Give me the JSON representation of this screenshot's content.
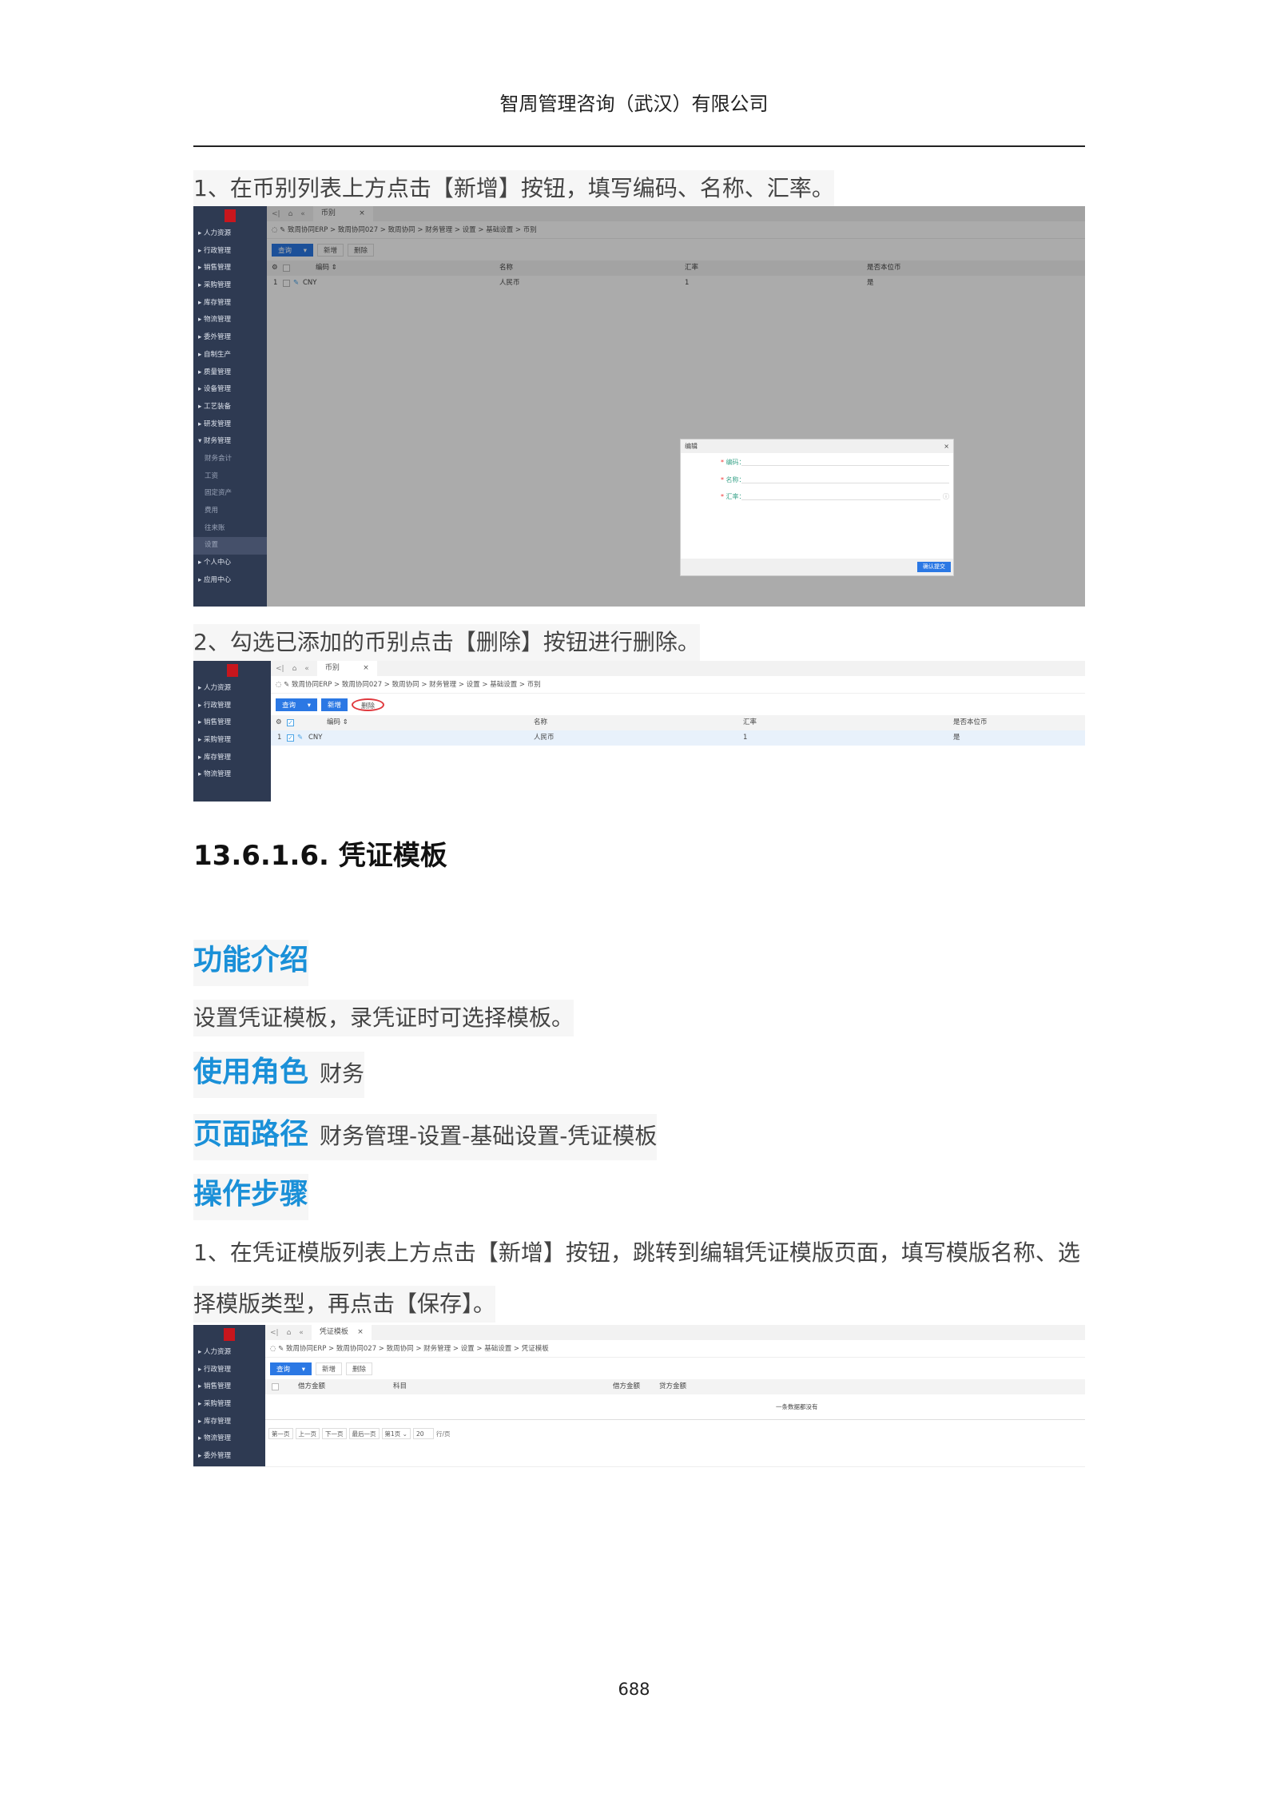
{
  "header": {
    "company": "智周管理咨询（武汉）有限公司"
  },
  "step1": "1、在币别列表上方点击【新增】按钮，填写编码、名称、汇率。",
  "step2": "2、勾选已添加的币别点击【删除】按钮进行删除。",
  "section_title": "13.6.1.6.  凭证模板",
  "intro": {
    "label": "功能介绍",
    "text": "设置凭证模板，录凭证时可选择模板。"
  },
  "role": {
    "label": "使用角色",
    "value": "财务"
  },
  "path": {
    "label": "页面路径",
    "value": "财务管理-设置-基础设置-凭证模板"
  },
  "steps": {
    "label": "操作步骤",
    "text1": "1、在凭证模版列表上方点击【新增】按钮，跳转到编辑凭证模版页面，填写模版名称、选",
    "text2": "择模版类型，再点击【保存】。"
  },
  "sidebar": {
    "items": [
      "人力资源",
      "行政管理",
      "销售管理",
      "采购管理",
      "库存管理",
      "物流管理",
      "委外管理",
      "自制生产",
      "质量管理",
      "设备管理",
      "工艺装备",
      "研发管理",
      "财务管理"
    ],
    "finance_sub": [
      "财务会计",
      "工资",
      "固定资产",
      "费用",
      "往来账",
      "设置"
    ],
    "bottom": [
      "个人中心",
      "应用中心"
    ]
  },
  "shot1": {
    "tab": "币别",
    "breadcrumb": "致周协同ERP > 致周协同027 > 致周协同 > 财务管理 > 设置 > 基础设置 > 币别",
    "query": "查询",
    "add": "新增",
    "delete": "删除",
    "columns": [
      "编码 ⇕",
      "名称",
      "汇率",
      "是否本位币"
    ],
    "row": {
      "index": "1",
      "code": "CNY",
      "name": "人民币",
      "rate": "1",
      "is_base": "是"
    },
    "dialog": {
      "title": "编辑",
      "fields": [
        "编码：",
        "名称：",
        "汇率："
      ],
      "submit": "确认提交"
    }
  },
  "shot2": {
    "tab": "币别",
    "breadcrumb": "致周协同ERP > 致周协同027 > 致周协同 > 财务管理 > 设置 > 基础设置 > 币别",
    "query": "查询",
    "add": "新增",
    "delete": "删除",
    "columns": [
      "编码 ⇕",
      "名称",
      "汇率",
      "是否本位币"
    ],
    "row": {
      "index": "1",
      "code": "CNY",
      "name": "人民币",
      "rate": "1",
      "is_base": "是"
    }
  },
  "shot3": {
    "tab": "凭证模板",
    "breadcrumb": "致周协同ERP > 致周协同027 > 致周协同 > 财务管理 > 设置 > 基础设置 > 凭证模板",
    "query": "查询",
    "add": "新增",
    "delete": "删除",
    "columns": [
      "借方金额",
      "科目",
      "借方金额",
      "贷方金额"
    ],
    "empty": "一条数据都没有",
    "pager": {
      "first": "第一页",
      "prev": "上一页",
      "next": "下一页",
      "last": "最后一页",
      "page": "第1页",
      "size": "20",
      "unit": "行/页"
    }
  },
  "page_number": "688"
}
